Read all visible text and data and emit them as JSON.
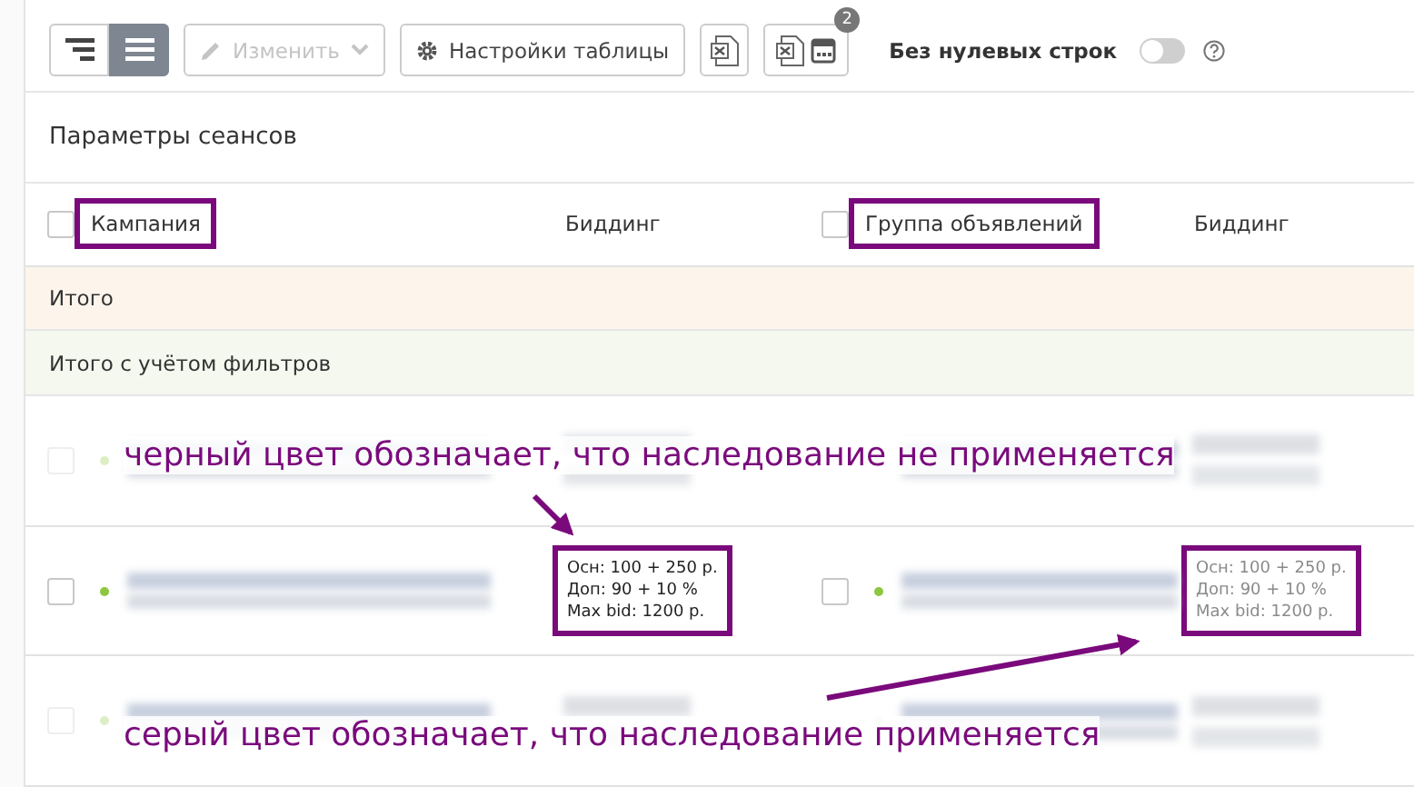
{
  "toolbar": {
    "view_buttons": [
      {
        "kind": "tree",
        "selected": false
      },
      {
        "kind": "flat",
        "selected": true
      }
    ],
    "edit_button": {
      "label": "Изменить",
      "disabled": true
    },
    "settings_button": {
      "label": "Настройки таблицы"
    },
    "export_schedule_badge": "2",
    "zero_rows_toggle": {
      "label": "Без нулевых строк",
      "on": false
    }
  },
  "panel": {
    "title": "Параметры сеансов"
  },
  "columns": [
    {
      "label": "Кампания",
      "kind": "name",
      "highlighted": true,
      "checked": false
    },
    {
      "label": "Биддинг",
      "kind": "bidding",
      "highlighted": false
    },
    {
      "label": "Группа объявлений",
      "kind": "name",
      "highlighted": true,
      "checked": false
    },
    {
      "label": "Биддинг",
      "kind": "bidding",
      "highlighted": false
    }
  ],
  "summary_rows": [
    {
      "label": "Итого",
      "kind": "total"
    },
    {
      "label": "Итого с учётом фильтров",
      "kind": "filtered"
    }
  ],
  "rows": [
    {
      "kind": "blurred",
      "campaign_checked": false
    },
    {
      "kind": "detail",
      "campaign_checked": false,
      "group_checked": false,
      "campaign_bidding": {
        "lines": [
          "Осн: 100 + 250 р.",
          "Доп: 90 + 10 %",
          "Max bid: 1200 р."
        ],
        "inherited": false,
        "highlighted": true
      },
      "group_bidding": {
        "lines": [
          "Осн: 100 + 250 р.",
          "Доп: 90 + 10 %",
          "Max bid: 1200 р."
        ],
        "inherited": true,
        "highlighted": true
      }
    },
    {
      "kind": "blurred",
      "campaign_checked": false
    }
  ],
  "annotations": [
    {
      "text": "черный цвет обозначает, что наследование не применяется"
    },
    {
      "text": "серый цвет обозначает, что наследование применяется"
    }
  ]
}
